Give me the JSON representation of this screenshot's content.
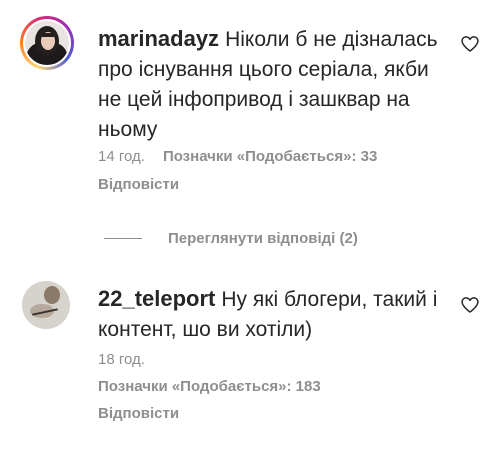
{
  "comments": [
    {
      "username": "marinadayz",
      "text": "Ніколи б не дізналась про існування цього серіала, якби не цей інфопривод і зашквар на ньому",
      "time": "14 год.",
      "likes": "Позначки «Подобається»: 33",
      "reply_label": "Відповісти",
      "avatar_icon": "profile-photo",
      "like_icon": "heart-outline-icon"
    },
    {
      "username": "22_teleport",
      "text": "Ну які блогери, такий і контент, шо ви хотіли)",
      "time": "18 год.",
      "likes": "Позначки «Подобається»: 183",
      "reply_label": "Відповісти",
      "avatar_icon": "profile-photo",
      "like_icon": "heart-outline-icon"
    }
  ],
  "view_replies_label": "Переглянути відповіді (2)",
  "colors": {
    "text": "#262626",
    "secondary": "#8e8e8e",
    "background": "#ffffff"
  }
}
